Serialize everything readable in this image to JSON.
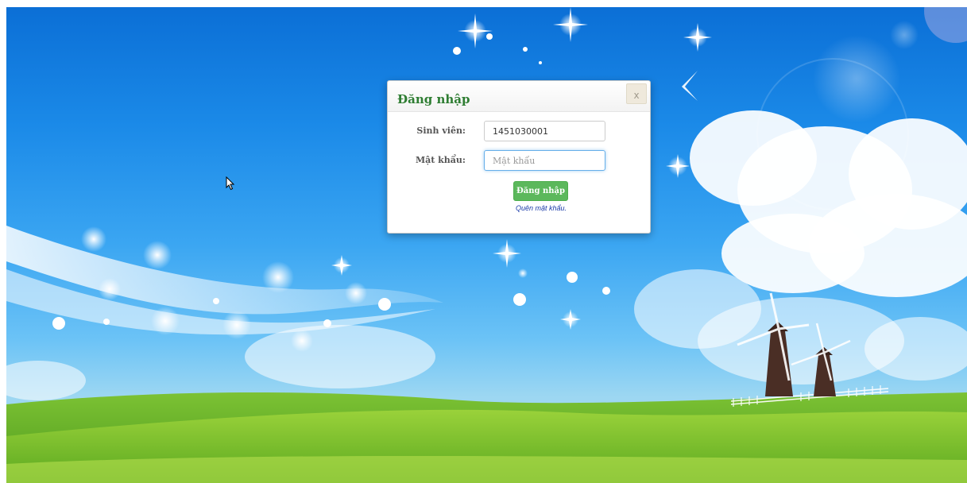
{
  "login": {
    "title": "Đăng nhập",
    "close_label": "x",
    "student_label": "Sinh viên:",
    "student_value": "1451030001",
    "password_label": "Mật khẩu:",
    "password_placeholder": "Mật khẩu",
    "submit_label": "Đăng nhập",
    "forgot_label": "Quên mật khẩu."
  },
  "colors": {
    "title_green": "#2e7d32",
    "button_green": "#5cb85c",
    "link_blue": "#1a3aa8",
    "focus_blue": "#66afe9"
  },
  "icons": [
    "sparkle-icon",
    "windmill-icon",
    "mouse-cursor-icon"
  ]
}
